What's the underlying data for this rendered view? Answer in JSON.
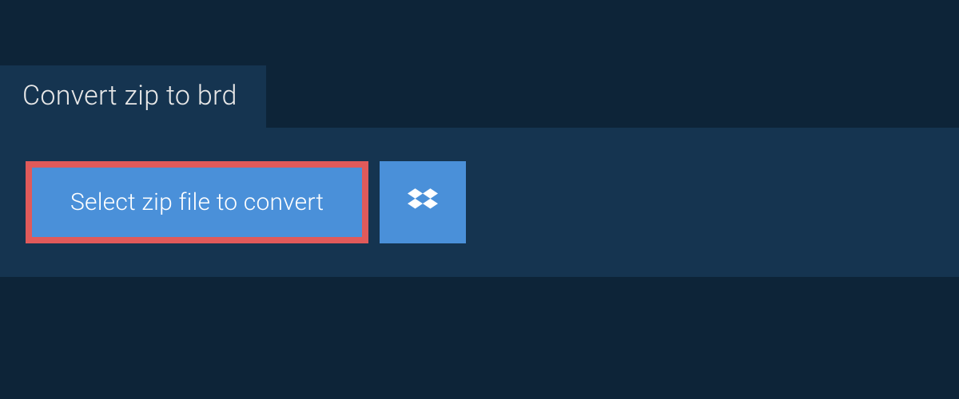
{
  "tab": {
    "title": "Convert zip to brd"
  },
  "actions": {
    "select_label": "Select zip file to convert",
    "dropbox_icon": "dropbox-icon"
  },
  "colors": {
    "background": "#0d2438",
    "panel": "#153450",
    "button": "#4a90d9",
    "highlight_border": "#e05a5a"
  }
}
